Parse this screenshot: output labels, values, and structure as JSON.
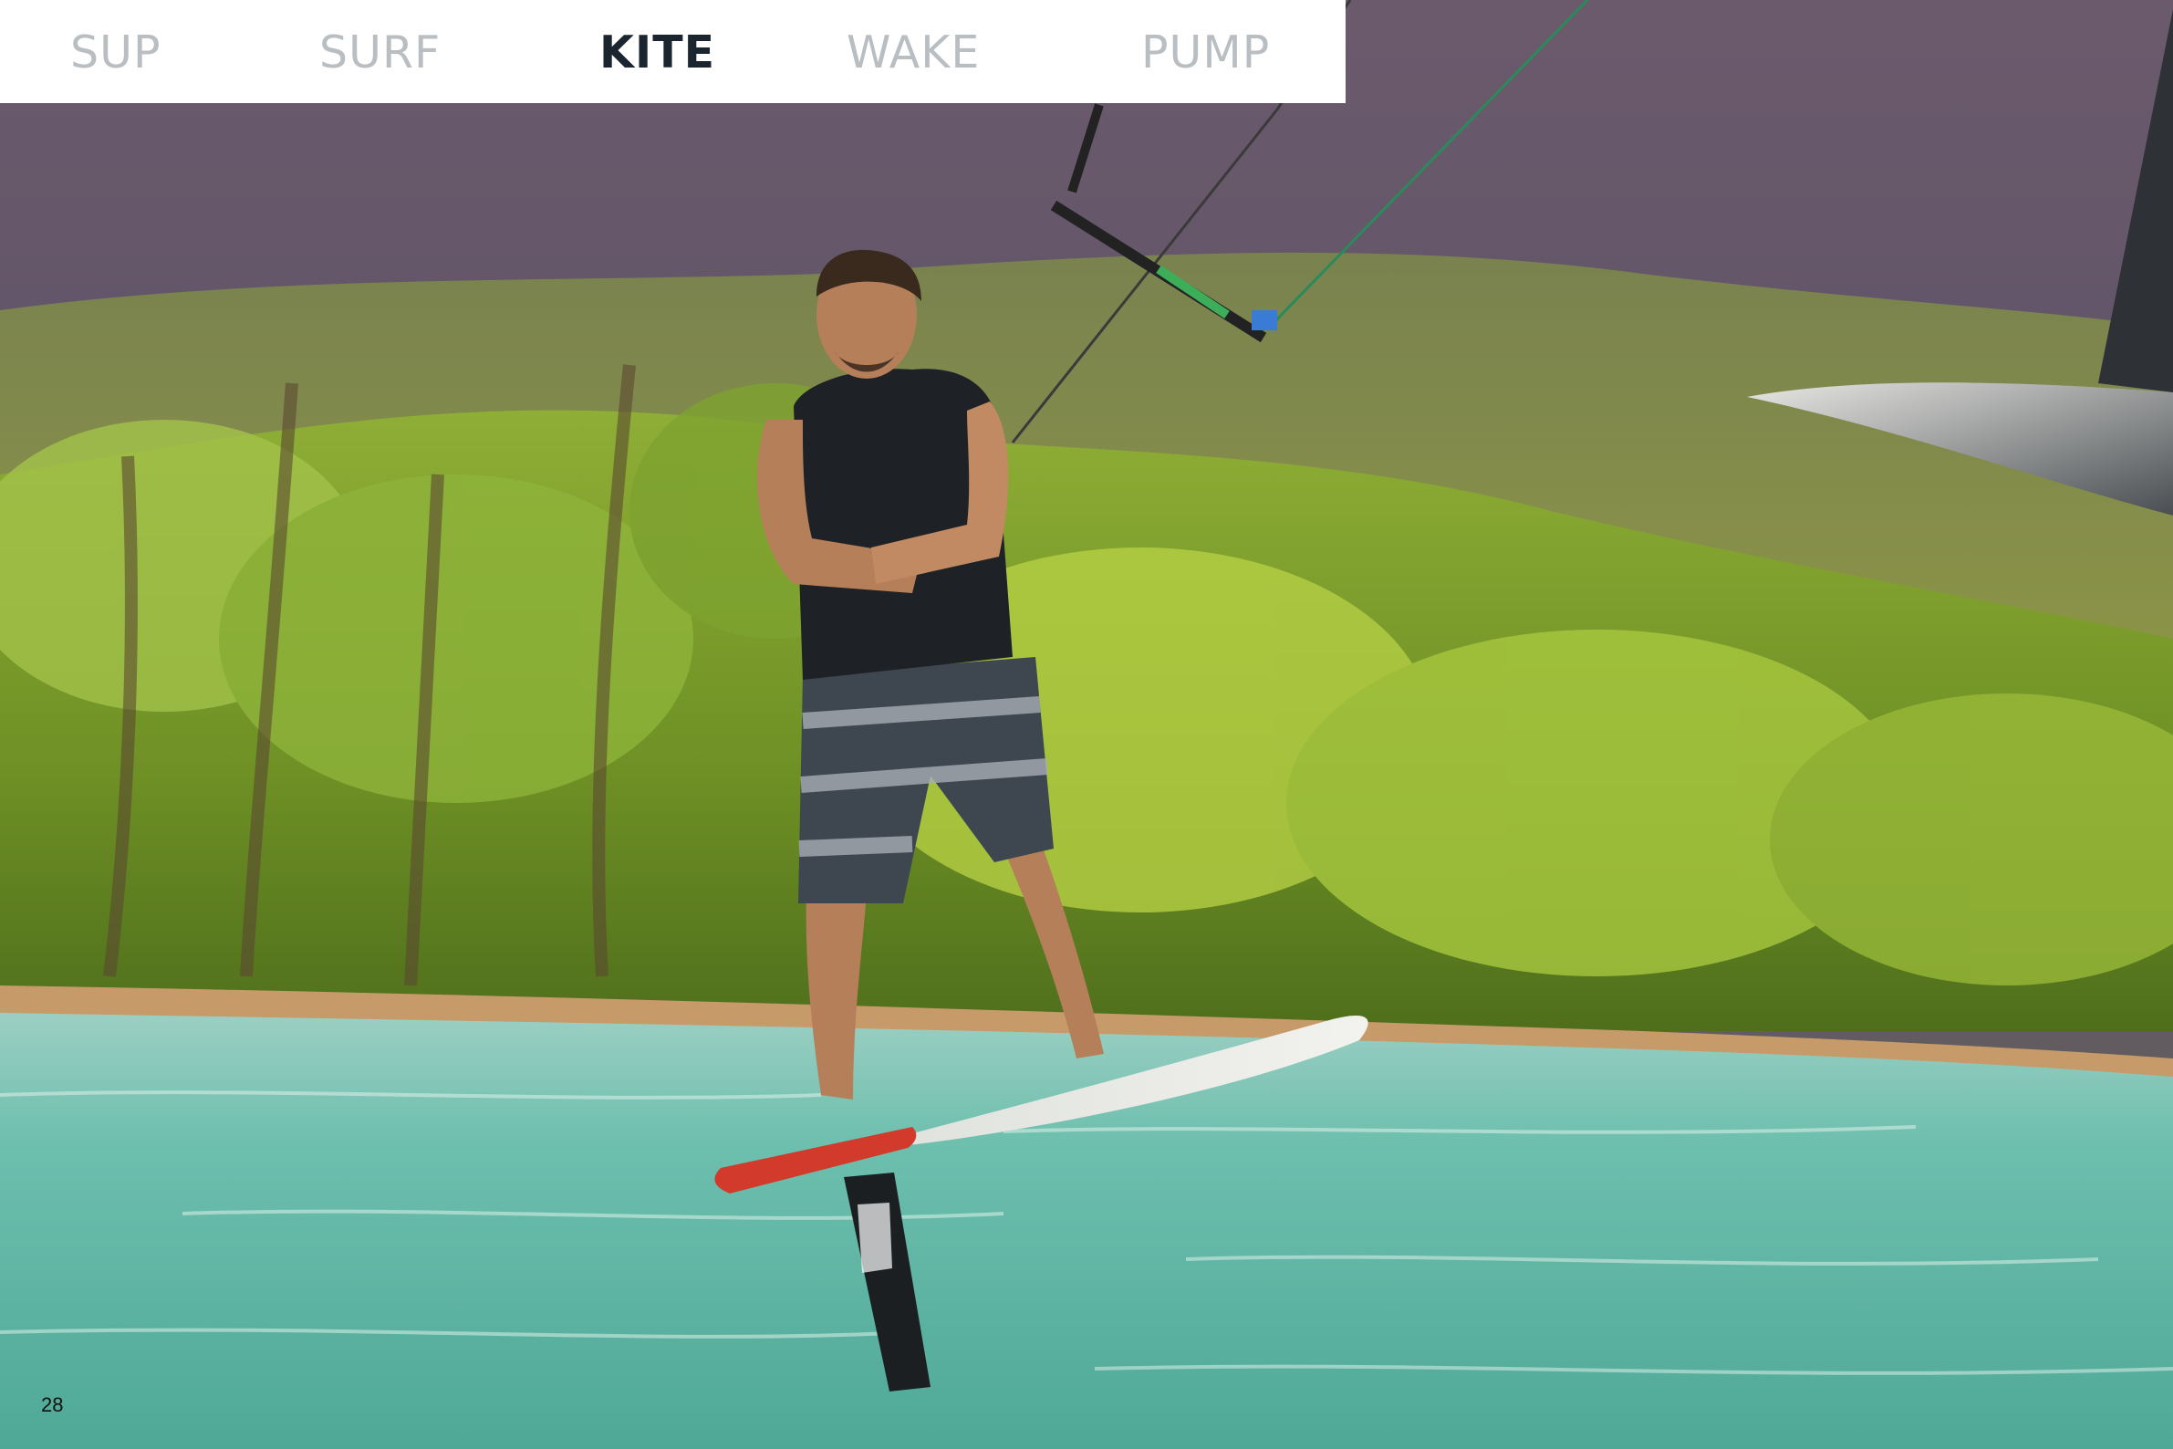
{
  "nav": {
    "tabs": [
      {
        "label": "SUP",
        "active": false
      },
      {
        "label": "SURF",
        "active": false
      },
      {
        "label": "KITE",
        "active": true
      },
      {
        "label": "WAKE",
        "active": false
      },
      {
        "label": "PUMP",
        "active": false
      }
    ]
  },
  "page_number": "28",
  "colors": {
    "active_tab": "#1a2530",
    "inactive_tab": "#b8bec2",
    "board_rail": "#d23a2b",
    "water": "#5fb7a4"
  }
}
